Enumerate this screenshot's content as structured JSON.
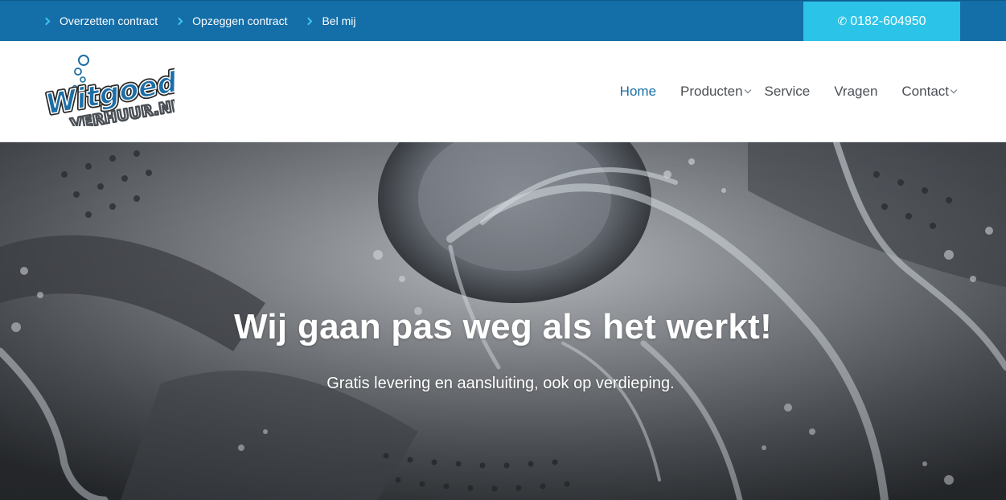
{
  "topbar": {
    "links": [
      {
        "label": "Overzetten contract"
      },
      {
        "label": "Opzeggen contract"
      },
      {
        "label": "Bel mij"
      }
    ],
    "phone": {
      "icon": "phone-icon",
      "number": "0182-604950"
    },
    "colors": {
      "bar": "#146ea8",
      "accent": "#2bc4e8"
    }
  },
  "logo": {
    "line1": "Witgoed",
    "line2": "VERHUUR.NL"
  },
  "nav": {
    "items": [
      {
        "label": "Home",
        "active": true
      },
      {
        "label": "Producten",
        "dropdown": true
      },
      {
        "label": "Service"
      },
      {
        "label": "Vragen"
      },
      {
        "label": "Contact",
        "dropdown": true
      }
    ]
  },
  "hero": {
    "title": "Wij gaan pas weg als het werkt!",
    "subtitle": "Gratis levering en aansluiting, ook op verdieping."
  }
}
